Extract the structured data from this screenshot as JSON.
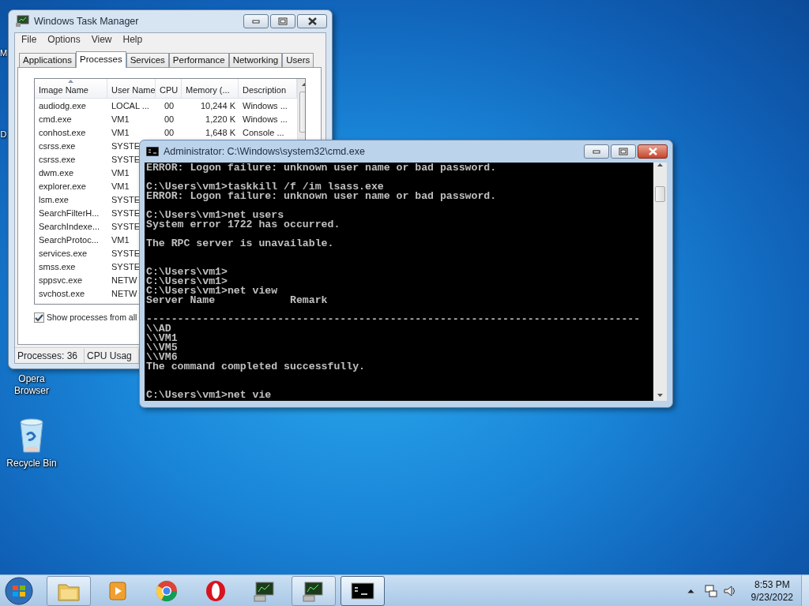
{
  "desktop_icons": [
    {
      "label": "M",
      "kind": "fragment"
    },
    {
      "label": "D",
      "kind": "fragment"
    },
    {
      "label": "Opera Browser",
      "kind": "label_only"
    },
    {
      "label": "Recycle Bin",
      "kind": "recycle_bin"
    }
  ],
  "task_manager": {
    "title": "Windows Task Manager",
    "menu": [
      "File",
      "Options",
      "View",
      "Help"
    ],
    "tabs": [
      {
        "label": "Applications",
        "selected": false
      },
      {
        "label": "Processes",
        "selected": true
      },
      {
        "label": "Services",
        "selected": false
      },
      {
        "label": "Performance",
        "selected": false
      },
      {
        "label": "Networking",
        "selected": false
      },
      {
        "label": "Users",
        "selected": false
      }
    ],
    "columns": [
      {
        "label": "Image Name",
        "sorted": true
      },
      {
        "label": "User Name",
        "sorted": false
      },
      {
        "label": "CPU",
        "sorted": false
      },
      {
        "label": "Memory (...",
        "sorted": false
      },
      {
        "label": "Description",
        "sorted": false
      }
    ],
    "rows": [
      [
        "audiodg.exe",
        "LOCAL ...",
        "00",
        "10,244 K",
        "Windows ..."
      ],
      [
        "cmd.exe",
        "VM1",
        "00",
        "1,220 K",
        "Windows ..."
      ],
      [
        "conhost.exe",
        "VM1",
        "00",
        "1,648 K",
        "Console ..."
      ],
      [
        "csrss.exe",
        "SYSTE"
      ],
      [
        "csrss.exe",
        "SYSTE"
      ],
      [
        "dwm.exe",
        "VM1"
      ],
      [
        "explorer.exe",
        "VM1"
      ],
      [
        "lsm.exe",
        "SYSTE"
      ],
      [
        "SearchFilterH...",
        "SYSTE"
      ],
      [
        "SearchIndexe...",
        "SYSTE"
      ],
      [
        "SearchProtoc...",
        "VM1"
      ],
      [
        "services.exe",
        "SYSTE"
      ],
      [
        "smss.exe",
        "SYSTE"
      ],
      [
        "sppsvc.exe",
        "NETW"
      ],
      [
        "svchost.exe",
        "NETW"
      ]
    ],
    "show_all": {
      "label": "Show processes from all",
      "checked": true
    },
    "status": [
      "Processes: 36",
      "CPU Usag"
    ]
  },
  "console": {
    "title": "Administrator: C:\\Windows\\system32\\cmd.exe",
    "lines": [
      {
        "kind": "text",
        "text": "ERROR: Logon failure: unknown user name or bad password."
      },
      {
        "kind": "blank"
      },
      {
        "kind": "text",
        "text": "C:\\Users\\vm1>taskkill /f /im lsass.exe"
      },
      {
        "kind": "text",
        "text": "ERROR: Logon failure: unknown user name or bad password."
      },
      {
        "kind": "blank"
      },
      {
        "kind": "text",
        "text": "C:\\Users\\vm1>net users"
      },
      {
        "kind": "text",
        "text": "System error 1722 has occurred."
      },
      {
        "kind": "blank"
      },
      {
        "kind": "text",
        "text": "The RPC server is unavailable."
      },
      {
        "kind": "blank"
      },
      {
        "kind": "blank"
      },
      {
        "kind": "text",
        "text": "C:\\Users\\vm1>"
      },
      {
        "kind": "text",
        "text": "C:\\Users\\vm1>"
      },
      {
        "kind": "text",
        "text": "C:\\Users\\vm1>net view"
      },
      {
        "kind": "text",
        "text": "Server Name            Remark"
      },
      {
        "kind": "blank"
      },
      {
        "kind": "text",
        "text": "-------------------------------------------------------------------------------"
      },
      {
        "kind": "text",
        "text": "\\\\AD"
      },
      {
        "kind": "text",
        "text": "\\\\VM1"
      },
      {
        "kind": "text",
        "text": "\\\\VM5"
      },
      {
        "kind": "text",
        "text": "\\\\VM6"
      },
      {
        "kind": "text",
        "text": "The command completed successfully."
      },
      {
        "kind": "blank"
      },
      {
        "kind": "blank"
      },
      {
        "kind": "text",
        "text": "C:\\Users\\vm1>net vie"
      }
    ]
  },
  "taskbar": {
    "items": [
      {
        "kind": "folder",
        "running": true,
        "active": false
      },
      {
        "kind": "media",
        "running": false,
        "active": false
      },
      {
        "kind": "browser_round",
        "running": false,
        "active": false
      },
      {
        "kind": "browser_ring",
        "running": false,
        "active": false
      },
      {
        "kind": "monitor",
        "running": false,
        "active": false
      },
      {
        "kind": "monitor",
        "running": true,
        "active": false
      },
      {
        "kind": "console",
        "running": true,
        "active": true
      }
    ],
    "clock": {
      "time": "8:53 PM",
      "date": "9/23/2022"
    }
  }
}
